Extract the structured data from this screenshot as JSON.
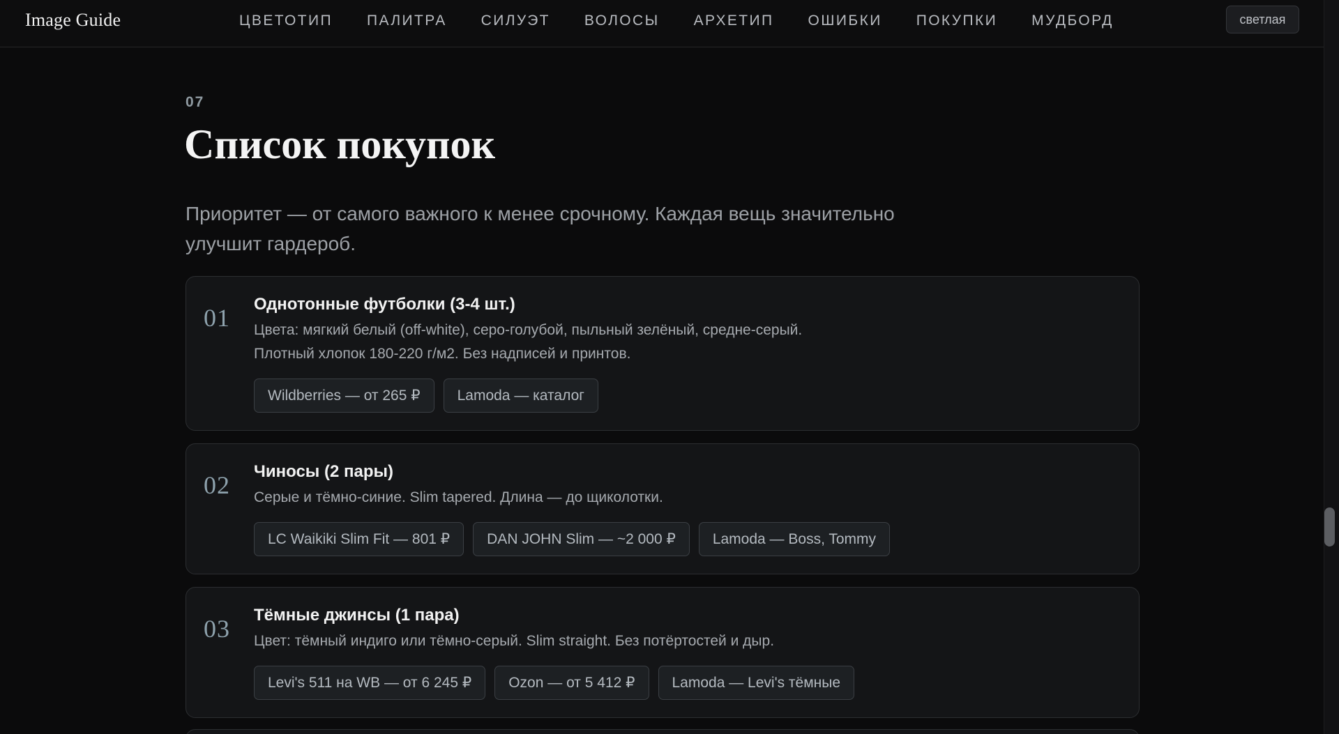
{
  "header": {
    "brand": "Image Guide",
    "nav": [
      "ЦВЕТОТИП",
      "ПАЛИТРА",
      "СИЛУЭТ",
      "ВОЛОСЫ",
      "АРХЕТИП",
      "ОШИБКИ",
      "ПОКУПКИ",
      "МУДБОРД"
    ],
    "theme_toggle_label": "светлая"
  },
  "section": {
    "number": "07",
    "title": "Список покупок",
    "description": "Приоритет — от самого важного к менее срочному. Каждая вещь значительно улучшит гардероб."
  },
  "items": [
    {
      "num": "01",
      "title": "Однотонные футболки (3-4 шт.)",
      "description": [
        "Цвета: мягкий белый (off-white), серо-голубой, пыльный зелёный, средне-серый.",
        "Плотный хлопок 180-220 г/м2. Без надписей и принтов."
      ],
      "links": [
        "Wildberries — от 265 ₽",
        "Lamoda — каталог"
      ]
    },
    {
      "num": "02",
      "title": "Чиносы (2 пары)",
      "description": [
        "Серые и тёмно-синие. Slim tapered. Длина — до щиколотки."
      ],
      "links": [
        "LC Waikiki Slim Fit — 801 ₽",
        "DAN JOHN Slim — ~2 000 ₽",
        "Lamoda — Boss, Tommy"
      ]
    },
    {
      "num": "03",
      "title": "Тёмные джинсы (1 пара)",
      "description": [
        "Цвет: тёмный индиго или тёмно-серый. Slim straight. Без потёртостей и дыр."
      ],
      "links": [
        "Levi's 511 на WB — от 6 245 ₽",
        "Ozon — от 5 412 ₽",
        "Lamoda — Levi's тёмные"
      ]
    }
  ]
}
